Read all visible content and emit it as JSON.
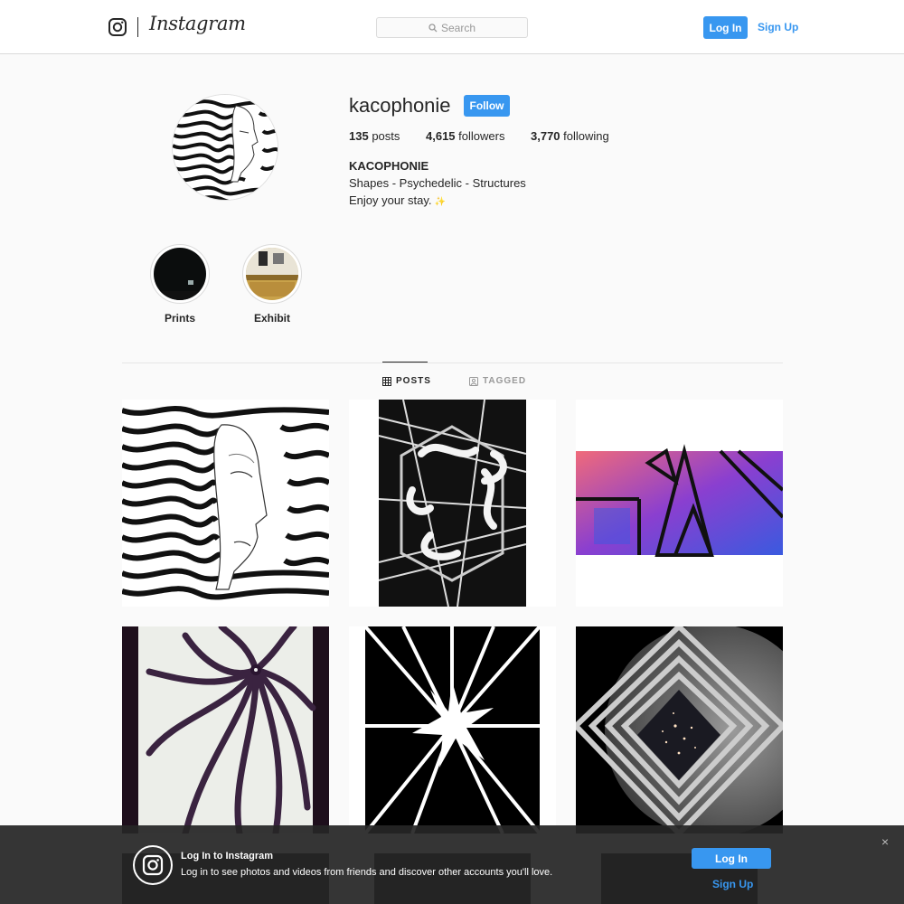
{
  "topnav": {
    "logo_icon": "instagram-glyph-icon",
    "wordmark": "Instagram",
    "search_placeholder": "Search",
    "search_icon": "search-icon",
    "login_label": "Log In",
    "signup_label": "Sign Up"
  },
  "profile": {
    "username": "kacophonie",
    "follow_label": "Follow",
    "stats": {
      "posts_count": "135",
      "posts_label": "posts",
      "followers_count": "4,615",
      "followers_label": "followers",
      "following_count": "3,770",
      "following_label": "following"
    },
    "bio": {
      "name": "KACOPHONIE",
      "line1": "Shapes - Psychedelic - Structures",
      "line2": "Enjoy your stay.",
      "sparkle": "✨"
    }
  },
  "highlights": [
    {
      "label": "Prints"
    },
    {
      "label": "Exhibit"
    }
  ],
  "tabs": {
    "posts": "POSTS",
    "tagged": "TAGGED"
  },
  "posts": [
    {
      "subject": "swirling-face-artwork"
    },
    {
      "subject": "geometric-swirl-artwork"
    },
    {
      "subject": "neon-triangle-artwork"
    },
    {
      "subject": "purple-tentacle-artwork"
    },
    {
      "subject": "starburst-artwork"
    },
    {
      "subject": "moon-diamond-artwork"
    }
  ],
  "banner": {
    "title": "Log In to Instagram",
    "text": "Log in to see photos and videos from friends and discover other accounts you'll love.",
    "login_label": "Log In",
    "signup_label": "Sign Up",
    "close_glyph": "×"
  },
  "colors": {
    "accent": "#3897f0",
    "text": "#262626",
    "muted": "#999999",
    "background": "#fafafa"
  }
}
